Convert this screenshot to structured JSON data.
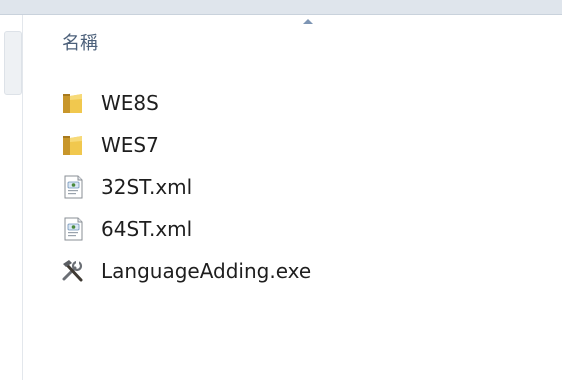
{
  "columns": {
    "name_label": "名稱"
  },
  "items": [
    {
      "label": "WE8S",
      "icon": "folder-icon"
    },
    {
      "label": "WES7",
      "icon": "folder-icon"
    },
    {
      "label": "32ST.xml",
      "icon": "xml-file-icon"
    },
    {
      "label": "64ST.xml",
      "icon": "xml-file-icon"
    },
    {
      "label": "LanguageAdding.exe",
      "icon": "tools-exe-icon"
    }
  ],
  "colors": {
    "header_text": "#4c607a",
    "folder": "#e9b843",
    "item_text": "#1e1e1e"
  }
}
